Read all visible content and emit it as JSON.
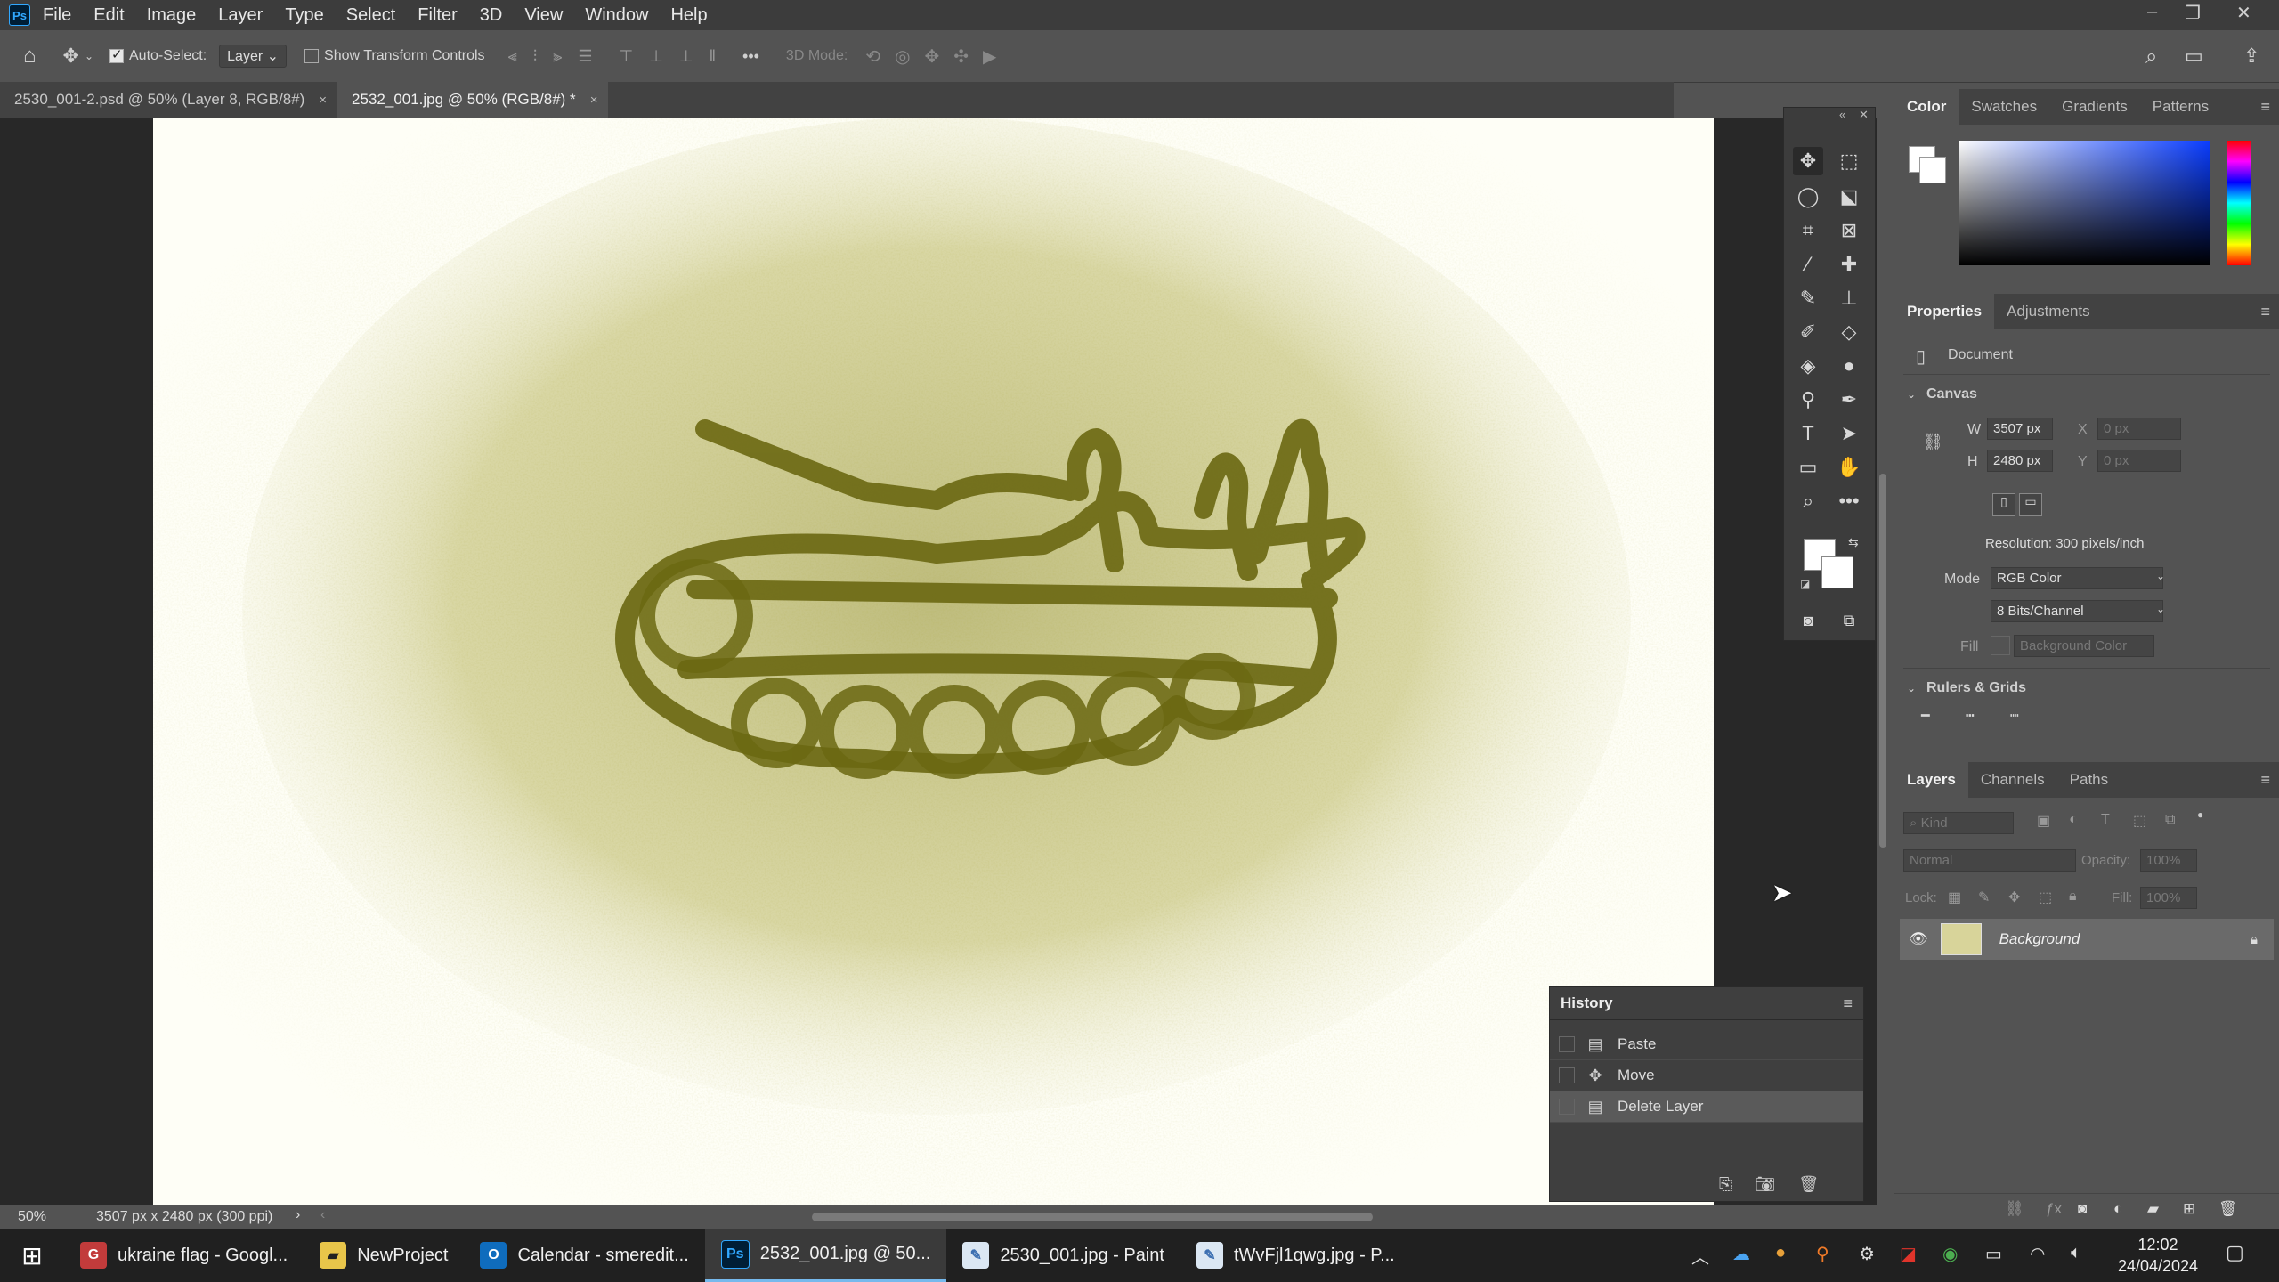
{
  "app": {
    "logo": "Ps"
  },
  "menu": [
    "File",
    "Edit",
    "Image",
    "Layer",
    "Type",
    "Select",
    "Filter",
    "3D",
    "View",
    "Window",
    "Help"
  ],
  "window_controls": {
    "minimize": "–",
    "restore": "❐",
    "close": "✕"
  },
  "options_bar": {
    "auto_select_label": "Auto-Select:",
    "auto_select_target": "Layer",
    "show_transform_label": "Show Transform Controls",
    "mode_3d_label": "3D Mode:",
    "more": "•••"
  },
  "tabs": [
    {
      "label": "2530_001-2.psd @ 50% (Layer 8, RGB/8#)",
      "close": "×"
    },
    {
      "label": "2532_001.jpg @ 50% (RGB/8#) *",
      "close": "×"
    }
  ],
  "color_panel": {
    "tabs": [
      "Color",
      "Swatches",
      "Gradients",
      "Patterns"
    ]
  },
  "properties_panel": {
    "tabs": [
      "Properties",
      "Adjustments"
    ],
    "doc_label": "Document",
    "canvas_heading": "Canvas",
    "w_label": "W",
    "w_value": "3507 px",
    "h_label": "H",
    "h_value": "2480 px",
    "x_label": "X",
    "x_value": "0 px",
    "y_label": "Y",
    "y_value": "0 px",
    "resolution": "Resolution: 300 pixels/inch",
    "mode_label": "Mode",
    "mode_value": "RGB Color",
    "bits_value": "8 Bits/Channel",
    "fill_label": "Fill",
    "fill_value": "Background Color",
    "rulers_heading": "Rulers & Grids"
  },
  "layers_panel": {
    "tabs": [
      "Layers",
      "Channels",
      "Paths"
    ],
    "kind_placeholder": "Kind",
    "blend_mode": "Normal",
    "opacity_label": "Opacity:",
    "opacity_value": "100%",
    "lock_label": "Lock:",
    "fill_label": "Fill:",
    "fill_value": "100%",
    "layers": [
      {
        "name": "Background",
        "visible": true,
        "locked": true
      }
    ]
  },
  "history_panel": {
    "title": "History",
    "items": [
      {
        "label": "Paste",
        "icon": "document-icon"
      },
      {
        "label": "Move",
        "icon": "move-icon"
      },
      {
        "label": "Delete Layer",
        "icon": "document-icon"
      }
    ]
  },
  "status_bar": {
    "zoom": "50%",
    "doc_info": "3507 px x 2480 px (300 ppi)"
  },
  "taskbar": {
    "items": [
      {
        "label": "ukraine flag - Googl...",
        "icon": "chrome-icon"
      },
      {
        "label": "NewProject",
        "icon": "folder-icon"
      },
      {
        "label": "Calendar - smeredit...",
        "icon": "outlook-icon"
      },
      {
        "label": "2532_001.jpg @ 50...",
        "icon": "photoshop-icon"
      },
      {
        "label": "2530_001.jpg - Paint",
        "icon": "paint-icon"
      },
      {
        "label": "tWvFjl1qwg.jpg - P...",
        "icon": "paint-icon"
      }
    ],
    "time": "12:02",
    "date": "24/04/2024"
  },
  "colors": {
    "accent": "#31a8ff",
    "ink": "#6e6a10"
  }
}
